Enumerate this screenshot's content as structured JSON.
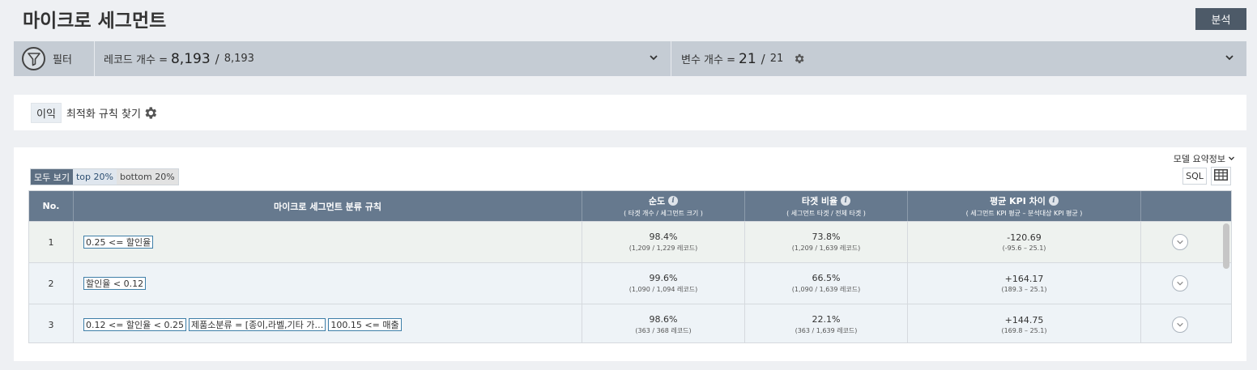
{
  "page": {
    "title": "마이크로 세그먼트",
    "analyze_label": "분석"
  },
  "filter_bar": {
    "filter_label": "필터",
    "record_label": "레코드 개수 =",
    "record_current": "8,193",
    "record_sep": "/",
    "record_total": "8,193",
    "var_label": "변수 개수 =",
    "var_current": "21",
    "var_sep": "/",
    "var_total": "21"
  },
  "rule_panel": {
    "tag": "이익",
    "title": "최적화 규칙 찾기"
  },
  "main": {
    "model_summary": "모델 요약정보",
    "view_toggle": [
      "모두 보기",
      "top 20%",
      "bottom 20%"
    ],
    "sql_label": "SQL"
  },
  "table": {
    "headers": {
      "no": "No.",
      "rule": "마이크로 세그먼트 분류 규칙",
      "purity": "순도",
      "purity_sub": "( 타겟 개수 / 세그먼트 크기 )",
      "target": "타겟 비율",
      "target_sub": "( 세그먼트 타겟 / 전체 타겟 )",
      "kpi": "평균 KPI 차이",
      "kpi_sub": "( 세그먼트 KPI 평균 – 분석대상 KPI 평균 )"
    },
    "rows": [
      {
        "no": "1",
        "rules": [
          "0.25 <= 할인율"
        ],
        "purity": "98.4%",
        "purity_sub": "(1,209 / 1,229 레코드)",
        "target": "73.8%",
        "target_sub": "(1,209 / 1,639 레코드)",
        "kpi": "-120.69",
        "kpi_sub": "(-95.6 – 25.1)"
      },
      {
        "no": "2",
        "rules": [
          "할인율 < 0.12"
        ],
        "purity": "99.6%",
        "purity_sub": "(1,090 / 1,094 레코드)",
        "target": "66.5%",
        "target_sub": "(1,090 / 1,639 레코드)",
        "kpi": "+164.17",
        "kpi_sub": "(189.3 – 25.1)"
      },
      {
        "no": "3",
        "rules": [
          "0.12 <= 할인율 < 0.25",
          "제품소분류 = [종이,라벨,기타 가…",
          "100.15 <= 매출"
        ],
        "purity": "98.6%",
        "purity_sub": "(363 / 368 레코드)",
        "target": "22.1%",
        "target_sub": "(363 / 1,639 레코드)",
        "kpi": "+144.75",
        "kpi_sub": "(169.8 – 25.1)"
      }
    ]
  },
  "icons": {
    "filter": "funnel-icon",
    "chevron": "chevron-down-icon",
    "gear": "gear-icon",
    "info": "info-icon",
    "grid": "table-grid-icon",
    "expand": "chevron-circle-icon"
  }
}
